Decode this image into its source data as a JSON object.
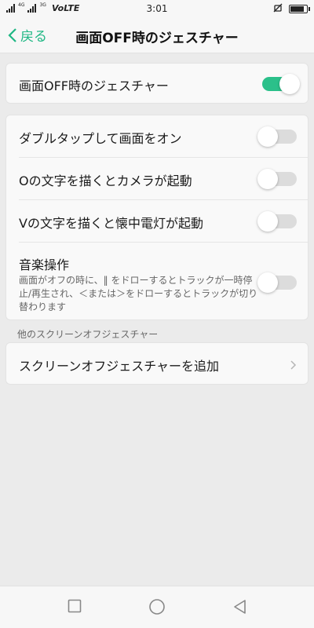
{
  "status_bar": {
    "network_top": "4G",
    "network_top2": "3G",
    "volte": "VoLTE",
    "time": "3:01",
    "battery_level": 0.9
  },
  "header": {
    "back_label": "戻る",
    "title": "画面OFF時のジェスチャー"
  },
  "master": {
    "label": "画面OFF時のジェスチャー",
    "enabled": true
  },
  "gestures": [
    {
      "label": "ダブルタップして画面をオン",
      "enabled": false
    },
    {
      "label": "Oの文字を描くとカメラが起動",
      "enabled": false
    },
    {
      "label": "Vの文字を描くと懐中電灯が起動",
      "enabled": false
    },
    {
      "label": "音楽操作",
      "description": "画面がオフの時に、‖ をドローするとトラックが一時停止/再生され、＜または＞をドローするとトラックが切り替わります",
      "enabled": false
    }
  ],
  "other_section": {
    "header": "他のスクリーンオフジェスチャー",
    "add_label": "スクリーンオフジェスチャーを追加"
  },
  "colors": {
    "accent": "#2bc08a",
    "back": "#1fb784"
  },
  "nav": {
    "recent": "square-icon",
    "home": "circle-icon",
    "back": "triangle-icon"
  }
}
